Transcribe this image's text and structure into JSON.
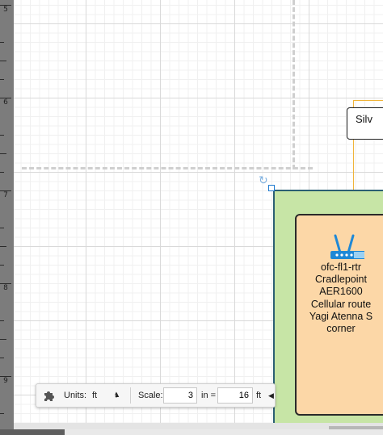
{
  "ruler": {
    "labels": [
      "5",
      "6",
      "7",
      "8",
      "9"
    ]
  },
  "diagram": {
    "silver_box_text": "Silv",
    "router_icon": "wireless-router-icon",
    "router_label_lines": [
      "ofc-fl1-rtr",
      "Cradlepoint",
      "AER1600",
      "Cellular route",
      "Yagi Atenna S",
      "corner"
    ],
    "colors": {
      "container_fill": "#c7e5a6",
      "container_border": "#2b5f73",
      "inner_fill": "#fcd7a7",
      "connector": "#f0b43a",
      "router_blue": "#1e88d6"
    }
  },
  "page_toolbar": {
    "icon": "puzzle-icon",
    "units_label": "Units:",
    "units_value": "ft",
    "scale_label": "Scale:",
    "scale_value": "3",
    "in_label": "in =",
    "ft_value": "16",
    "ft_label": "ft",
    "collapse_icon": "caret-left-icon"
  }
}
